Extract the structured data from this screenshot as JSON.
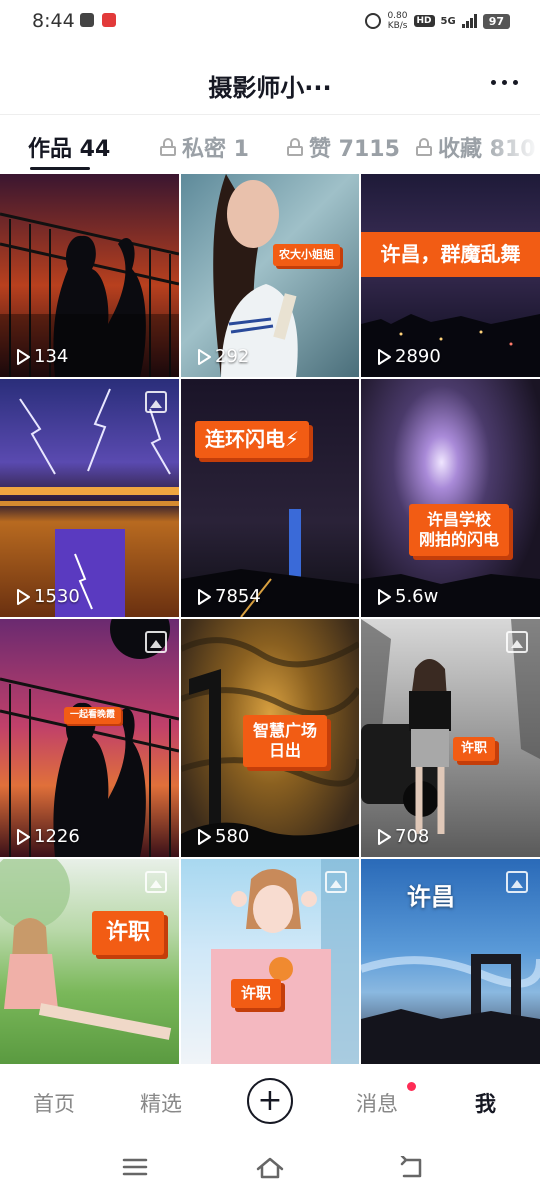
{
  "status_bar": {
    "time": "8:44",
    "net_speed_value": "0.80",
    "net_speed_unit": "KB/s",
    "hd_label": "HD",
    "network_label": "5G",
    "battery_level": "97"
  },
  "header": {
    "title": "摄影师小···"
  },
  "tabs": [
    {
      "label": "作品 44",
      "locked": false,
      "active": true
    },
    {
      "label": "私密 1",
      "locked": true,
      "active": false
    },
    {
      "label": "赞 7115",
      "locked": true,
      "active": false
    },
    {
      "label": "收藏 810",
      "locked": true,
      "active": false
    }
  ],
  "videos": [
    {
      "views": "134",
      "overlay": ""
    },
    {
      "views": "292",
      "overlay": "农大小姐姐"
    },
    {
      "views": "2890",
      "overlay": "许昌，群魔乱舞"
    },
    {
      "views": "1530",
      "overlay": ""
    },
    {
      "views": "7854",
      "overlay": "连环闪电⚡"
    },
    {
      "views": "5.6w",
      "overlay_line1": "许昌学校",
      "overlay_line2": "刚拍的闪电"
    },
    {
      "views": "1226",
      "overlay": "一起看晚霞"
    },
    {
      "views": "580",
      "overlay_line1": "智慧广场",
      "overlay_line2": "日出"
    },
    {
      "views": "708",
      "overlay": "许职"
    },
    {
      "overlay": "许职"
    },
    {
      "overlay": "许职"
    },
    {
      "overlay": "许昌"
    }
  ],
  "bottom_nav": {
    "home": "首页",
    "featured": "精选",
    "create": "+",
    "messages": "消息",
    "me": "我"
  },
  "colors": {
    "accent_orange": "#f25c14",
    "notification_red": "#fe2c55",
    "text_primary": "#161823",
    "text_muted": "#9aa0a6"
  }
}
